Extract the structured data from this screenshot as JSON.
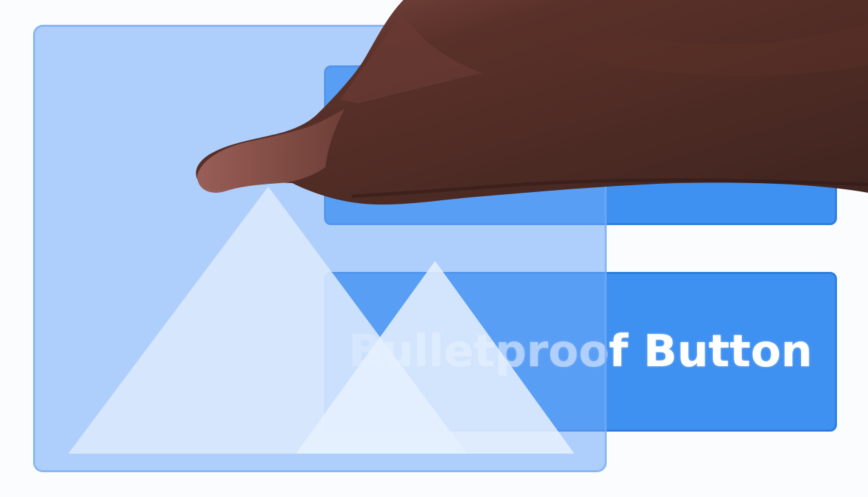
{
  "buttons": {
    "top": {
      "label": ""
    },
    "bottom": {
      "label": "Bulletproof Button"
    }
  },
  "image_placeholder": {
    "icon": "mountain-icon"
  },
  "overlay": {
    "icon": "hand-icon"
  },
  "colors": {
    "background": "#fbfcfe",
    "button_blue": "#3e90f1",
    "button_border": "#2d7ddf",
    "placeholder_blue": "#70aaf7",
    "mountain_light": "#dbe9fd",
    "hand_brown": "#4b2a24"
  }
}
